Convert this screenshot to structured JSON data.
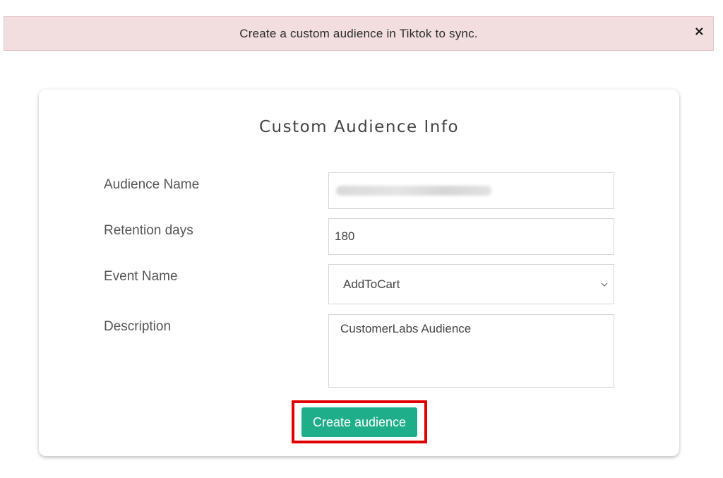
{
  "alert": {
    "message": "Create a custom audience in Tiktok to sync.",
    "close_symbol": "×",
    "background_color": "#f2dedf"
  },
  "form": {
    "title": "Custom Audience Info",
    "fields": {
      "audience_name": {
        "label": "Audience Name",
        "value": ""
      },
      "retention_days": {
        "label": "Retention days",
        "value": "180"
      },
      "event_name": {
        "label": "Event Name",
        "selected": "AddToCart",
        "icon": "chevron-down-icon"
      },
      "description": {
        "label": "Description",
        "value": "CustomerLabs Audience"
      }
    },
    "submit": {
      "label": "Create audience",
      "color": "#1fae8a",
      "highlight_color": "#e00000"
    }
  }
}
